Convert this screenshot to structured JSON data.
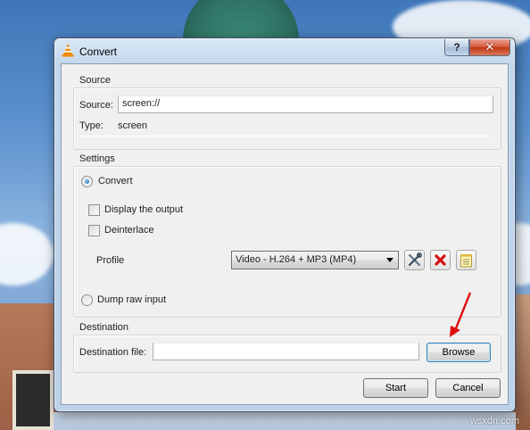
{
  "window": {
    "title": "Convert",
    "help_label": "?",
    "close_label": "✕"
  },
  "source": {
    "group_title": "Source",
    "source_label": "Source:",
    "source_value": "screen://",
    "type_label": "Type:",
    "type_value": "screen"
  },
  "settings": {
    "group_title": "Settings",
    "convert_label": "Convert",
    "convert_selected": true,
    "display_output_label": "Display the output",
    "deinterlace_label": "Deinterlace",
    "profile_label": "Profile",
    "profile_value": "Video - H.264 + MP3 (MP4)",
    "dump_raw_label": "Dump raw input",
    "edit_profile_icon": "wrench-screwdriver-icon",
    "delete_profile_icon": "red-x-icon",
    "new_profile_icon": "notepad-icon"
  },
  "destination": {
    "group_title": "Destination",
    "file_label": "Destination file:",
    "file_value": "",
    "browse_label": "Browse"
  },
  "buttons": {
    "start_label": "Start",
    "cancel_label": "Cancel"
  },
  "watermark": "wsxdn.com",
  "colors": {
    "annotation_arrow": "#e01010",
    "close_button": "#c23512"
  }
}
